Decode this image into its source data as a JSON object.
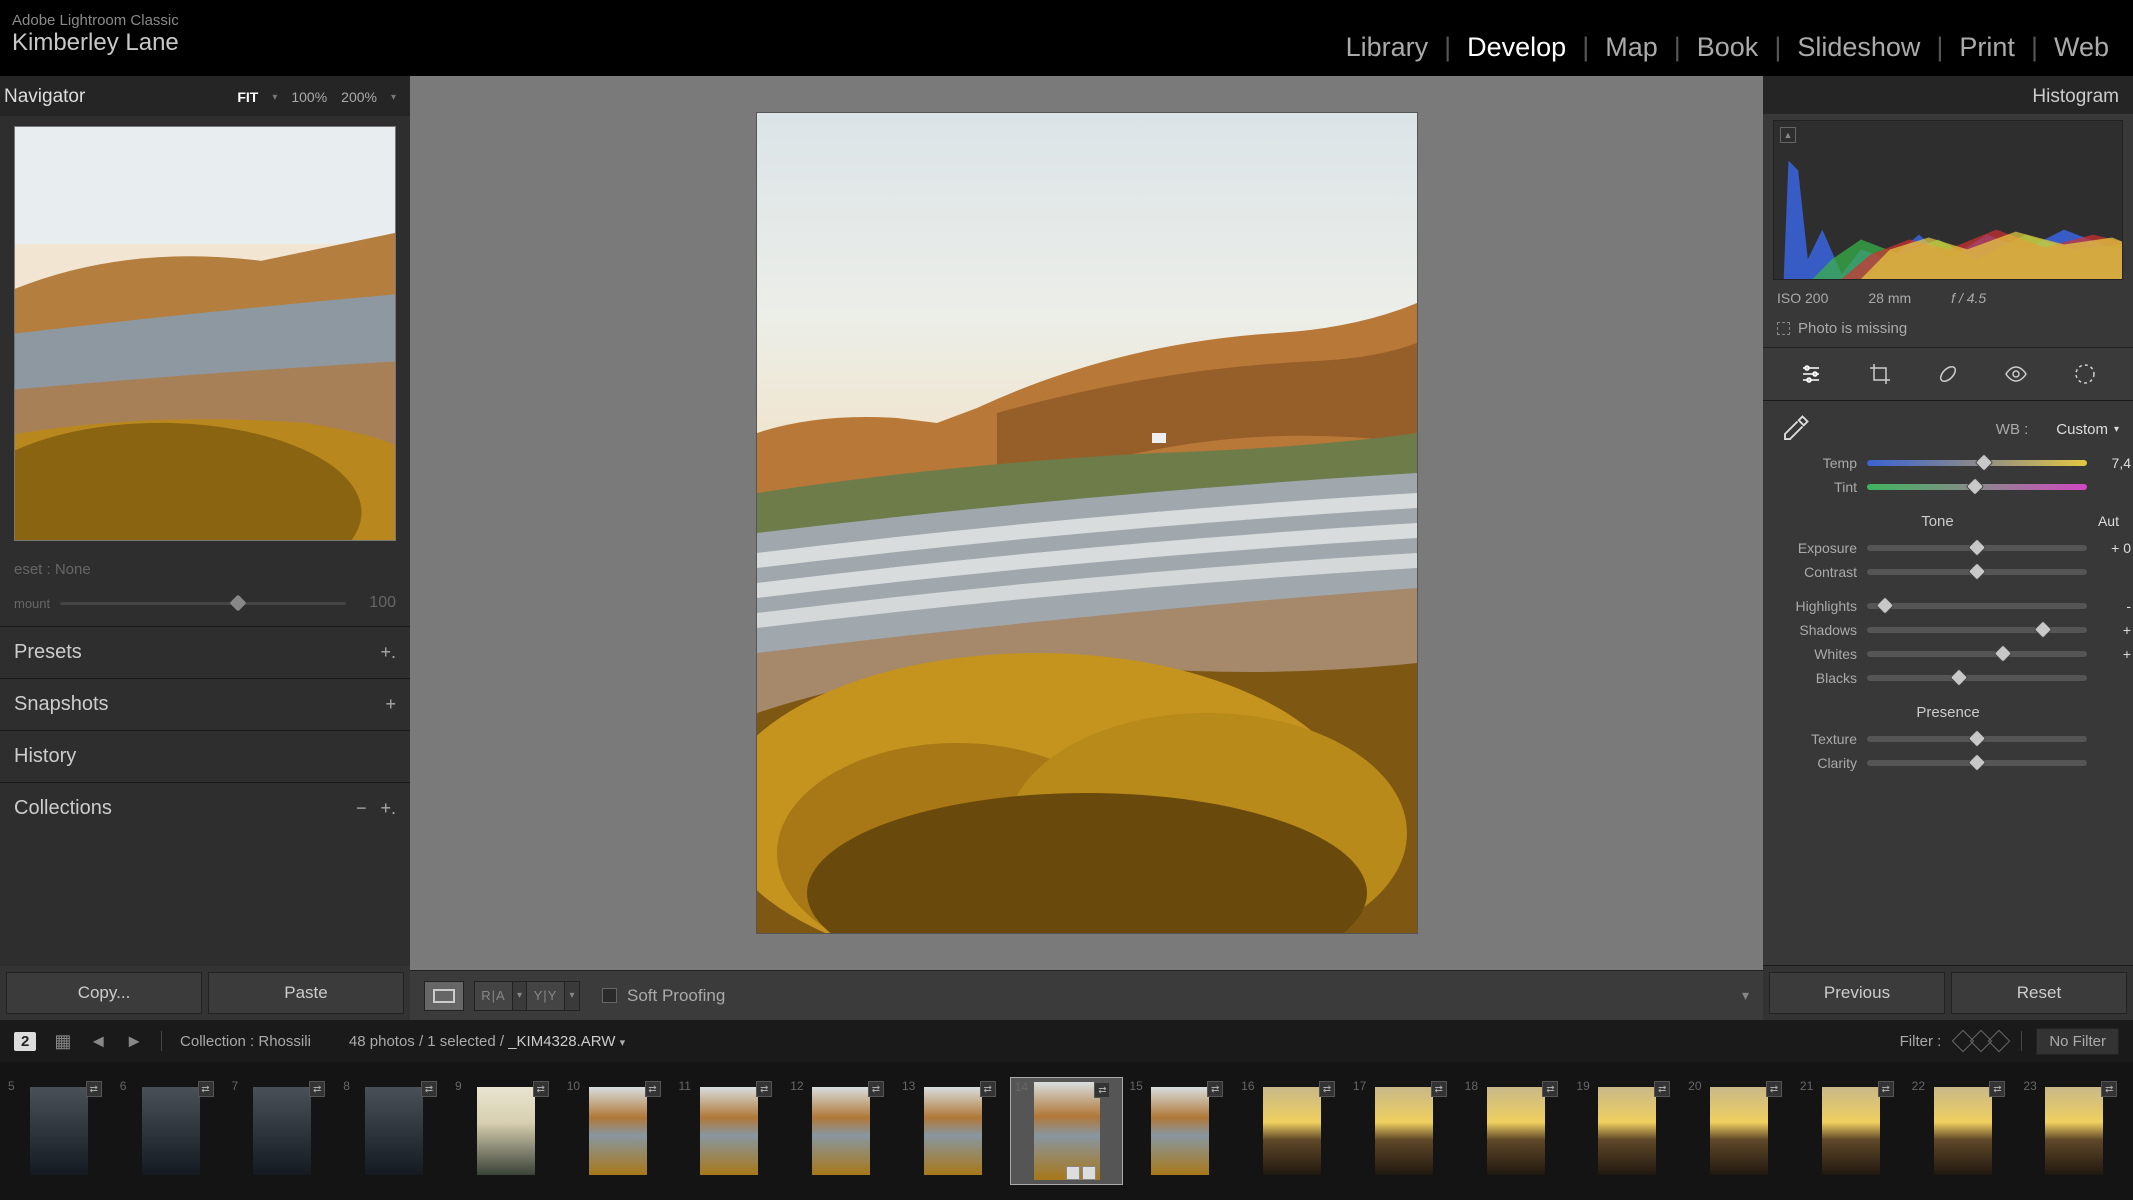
{
  "app": {
    "title": "Adobe Lightroom Classic",
    "user": "Kimberley Lane"
  },
  "header_tabs": [
    "Library",
    "Develop",
    "Map",
    "Book",
    "Slideshow",
    "Print",
    "Web"
  ],
  "active_header_tab": "Develop",
  "left": {
    "navigator_title": "Navigator",
    "zoom_labels": {
      "fit": "FIT",
      "z100": "100%",
      "z200": "200%"
    },
    "preset_label": "eset : None",
    "amount_label": "mount",
    "amount_value": "100",
    "sections": {
      "presets": "Presets",
      "snapshots": "Snapshots",
      "history": "History",
      "collections": "Collections"
    },
    "copy_btn": "Copy...",
    "paste_btn": "Paste"
  },
  "center": {
    "soft_proof": "Soft Proofing"
  },
  "right": {
    "histogram_title": "Histogram",
    "exif": {
      "iso": "ISO 200",
      "focal": "28 mm",
      "aperture": "f / 4.5"
    },
    "missing": "Photo is missing",
    "wb": {
      "label": "WB :",
      "value": "Custom"
    },
    "sliders": {
      "temp": {
        "label": "Temp",
        "value": "7,4",
        "pos": 53
      },
      "tint": {
        "label": "Tint",
        "value": "",
        "pos": 49
      },
      "tone_head": "Tone",
      "auto": "Aut",
      "exposure": {
        "label": "Exposure",
        "value": "+ 0",
        "pos": 50
      },
      "contrast": {
        "label": "Contrast",
        "value": "",
        "pos": 50
      },
      "highlights": {
        "label": "Highlights",
        "value": "-",
        "pos": 8
      },
      "shadows": {
        "label": "Shadows",
        "value": "+",
        "pos": 80
      },
      "whites": {
        "label": "Whites",
        "value": "+",
        "pos": 62
      },
      "blacks": {
        "label": "Blacks",
        "value": "",
        "pos": 42
      },
      "presence_head": "Presence",
      "texture": {
        "label": "Texture",
        "value": "",
        "pos": 50
      },
      "clarity": {
        "label": "Clarity",
        "value": "",
        "pos": 50
      }
    },
    "prev_btn": "Previous",
    "reset_btn": "Reset"
  },
  "info_bar": {
    "badge": "2",
    "collection": "Collection : Rhossili",
    "count": "48 photos / 1 selected /",
    "filename": "_KIM4328.ARW",
    "filter_label": "Filter :",
    "filter_value": "No Filter"
  },
  "filmstrip": {
    "start_num": 5,
    "selected_index": 14,
    "thumbs": [
      {
        "n": 5,
        "style": "dark"
      },
      {
        "n": 6,
        "style": "dark"
      },
      {
        "n": 7,
        "style": "dark"
      },
      {
        "n": 8,
        "style": "dark"
      },
      {
        "n": 9,
        "style": "sun"
      },
      {
        "n": 10,
        "style": "coast"
      },
      {
        "n": 11,
        "style": "coast"
      },
      {
        "n": 12,
        "style": "coast"
      },
      {
        "n": 13,
        "style": "coast"
      },
      {
        "n": 14,
        "style": "coast"
      },
      {
        "n": 15,
        "style": "coast"
      },
      {
        "n": 16,
        "style": "sunset"
      },
      {
        "n": 17,
        "style": "sunset"
      },
      {
        "n": 18,
        "style": "sunset"
      },
      {
        "n": 19,
        "style": "sunset"
      },
      {
        "n": 20,
        "style": "sunset"
      },
      {
        "n": 21,
        "style": "sunset"
      },
      {
        "n": 22,
        "style": "sunset"
      },
      {
        "n": 23,
        "style": "sunset"
      }
    ]
  }
}
